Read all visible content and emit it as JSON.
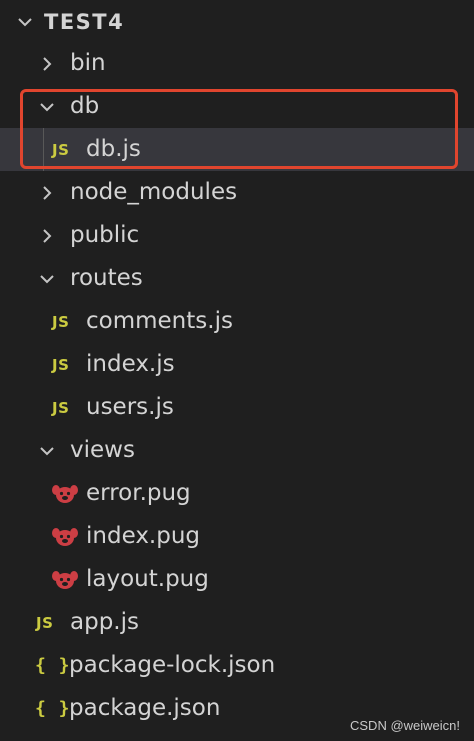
{
  "explorer": {
    "root": {
      "label": "TEST4",
      "expanded": true
    },
    "items": [
      {
        "label": "bin",
        "type": "folder",
        "expanded": false
      },
      {
        "label": "db",
        "type": "folder",
        "expanded": true
      },
      {
        "label": "db.js",
        "type": "js",
        "icon_text": "JS",
        "selected": true
      },
      {
        "label": "node_modules",
        "type": "folder",
        "expanded": false
      },
      {
        "label": "public",
        "type": "folder",
        "expanded": false
      },
      {
        "label": "routes",
        "type": "folder",
        "expanded": true
      },
      {
        "label": "comments.js",
        "type": "js",
        "icon_text": "JS"
      },
      {
        "label": "index.js",
        "type": "js",
        "icon_text": "JS"
      },
      {
        "label": "users.js",
        "type": "js",
        "icon_text": "JS"
      },
      {
        "label": "views",
        "type": "folder",
        "expanded": true
      },
      {
        "label": "error.pug",
        "type": "pug",
        "icon": "pug-icon"
      },
      {
        "label": "index.pug",
        "type": "pug",
        "icon": "pug-icon"
      },
      {
        "label": "layout.pug",
        "type": "pug",
        "icon": "pug-icon"
      },
      {
        "label": "app.js",
        "type": "js",
        "icon_text": "JS"
      },
      {
        "label": "package-lock.json",
        "type": "json",
        "icon_text": "{ }"
      },
      {
        "label": "package.json",
        "type": "json",
        "icon_text": "{ }"
      }
    ]
  },
  "annotation": {
    "color": "#e0452e"
  },
  "colors": {
    "background": "#1f1f1f",
    "selected_row": "#37373d",
    "js_icon": "#cbcb41",
    "json_icon": "#cbcb41",
    "pug_icon": "#cc3e44",
    "text": "#d4d4d4"
  },
  "watermark": "CSDN @weiweicn!"
}
